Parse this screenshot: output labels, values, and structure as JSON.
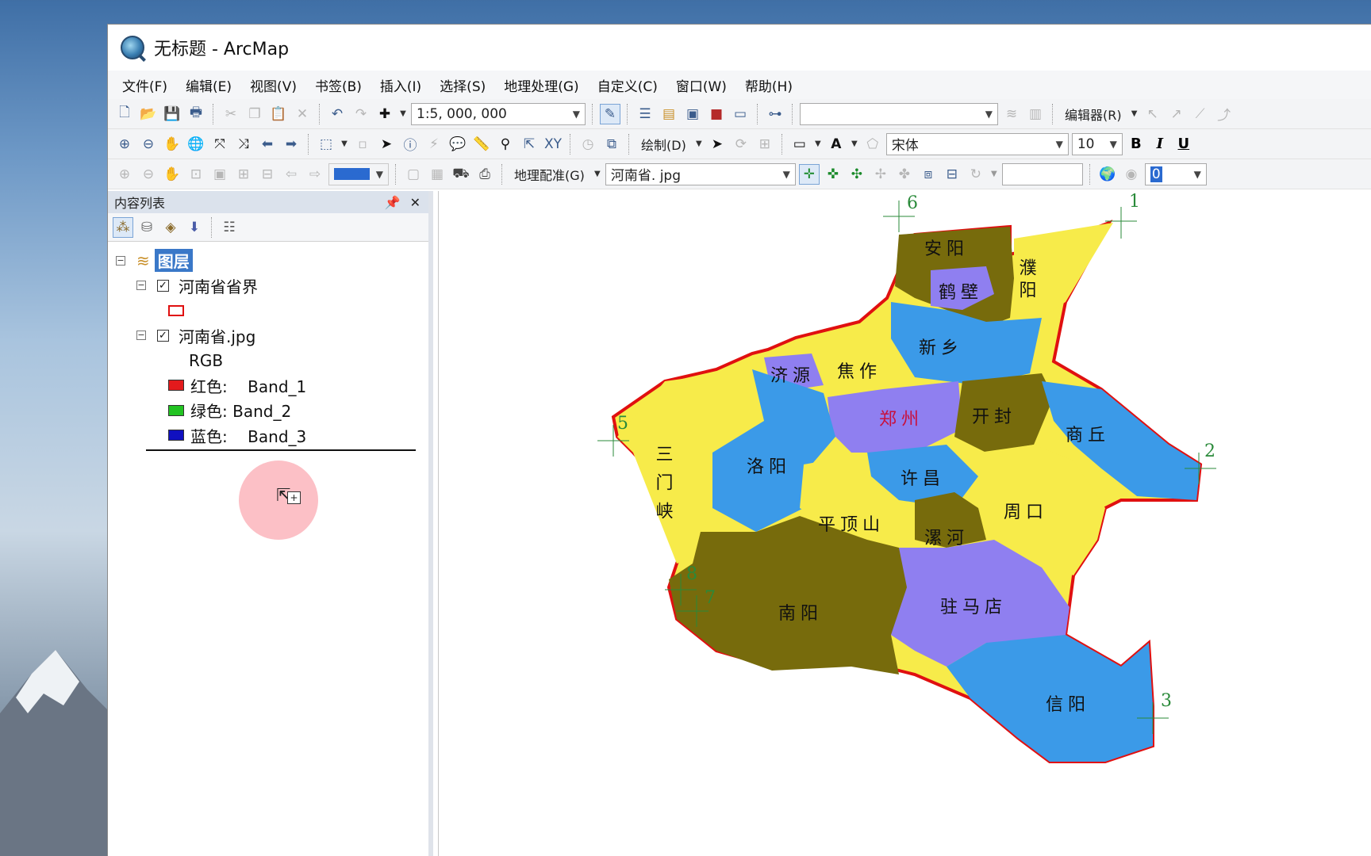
{
  "window": {
    "title": "无标题 - ArcMap"
  },
  "watermark": "bili",
  "menu": [
    "文件(F)",
    "编辑(E)",
    "视图(V)",
    "书签(B)",
    "插入(I)",
    "选择(S)",
    "地理处理(G)",
    "自定义(C)",
    "窗口(W)",
    "帮助(H)"
  ],
  "toolbar1": {
    "scale": "1:5, 000, 000",
    "layer_combo": "",
    "editor_label": "编辑器(R)"
  },
  "toolbar2": {
    "draw_label": "绘制(D)",
    "font_name": "宋体",
    "font_size": "10",
    "bold": "B",
    "italic": "I",
    "underline": "U"
  },
  "toolbar3": {
    "color_value": "100%",
    "georef_label": "地理配准(G)",
    "georef_layer": "河南省. jpg",
    "value_input": "",
    "link_count": "0"
  },
  "toc": {
    "title": "内容列表",
    "layers_label": "图层",
    "layer1": {
      "name": "河南省省界",
      "checked": "✓"
    },
    "layer2": {
      "name": "河南省.jpg",
      "checked": "✓",
      "rgb_label": "RGB"
    },
    "bands": [
      {
        "label": "红色:    Band_1",
        "color": "#e31a1c"
      },
      {
        "label": "绿色: Band_2",
        "color": "#22c322"
      },
      {
        "label": "蓝色:    Band_3",
        "color": "#1010c0"
      }
    ]
  },
  "map": {
    "regions": [
      "安阳",
      "鹤壁",
      "濮阳",
      "新乡",
      "济源",
      "焦作",
      "郑州",
      "开封",
      "商丘",
      "三门峡",
      "洛阳",
      "许昌",
      "周口",
      "平顶山",
      "漯河",
      "南阳",
      "驻马店",
      "信阳"
    ],
    "control_points": [
      "1",
      "2",
      "3",
      "5",
      "6",
      "7",
      "8"
    ],
    "colors": {
      "yellow": "#f7eb4a",
      "blue": "#3b9ae8",
      "purple": "#8f7ff0",
      "olive": "#776b0c",
      "border": "#e01010"
    }
  }
}
